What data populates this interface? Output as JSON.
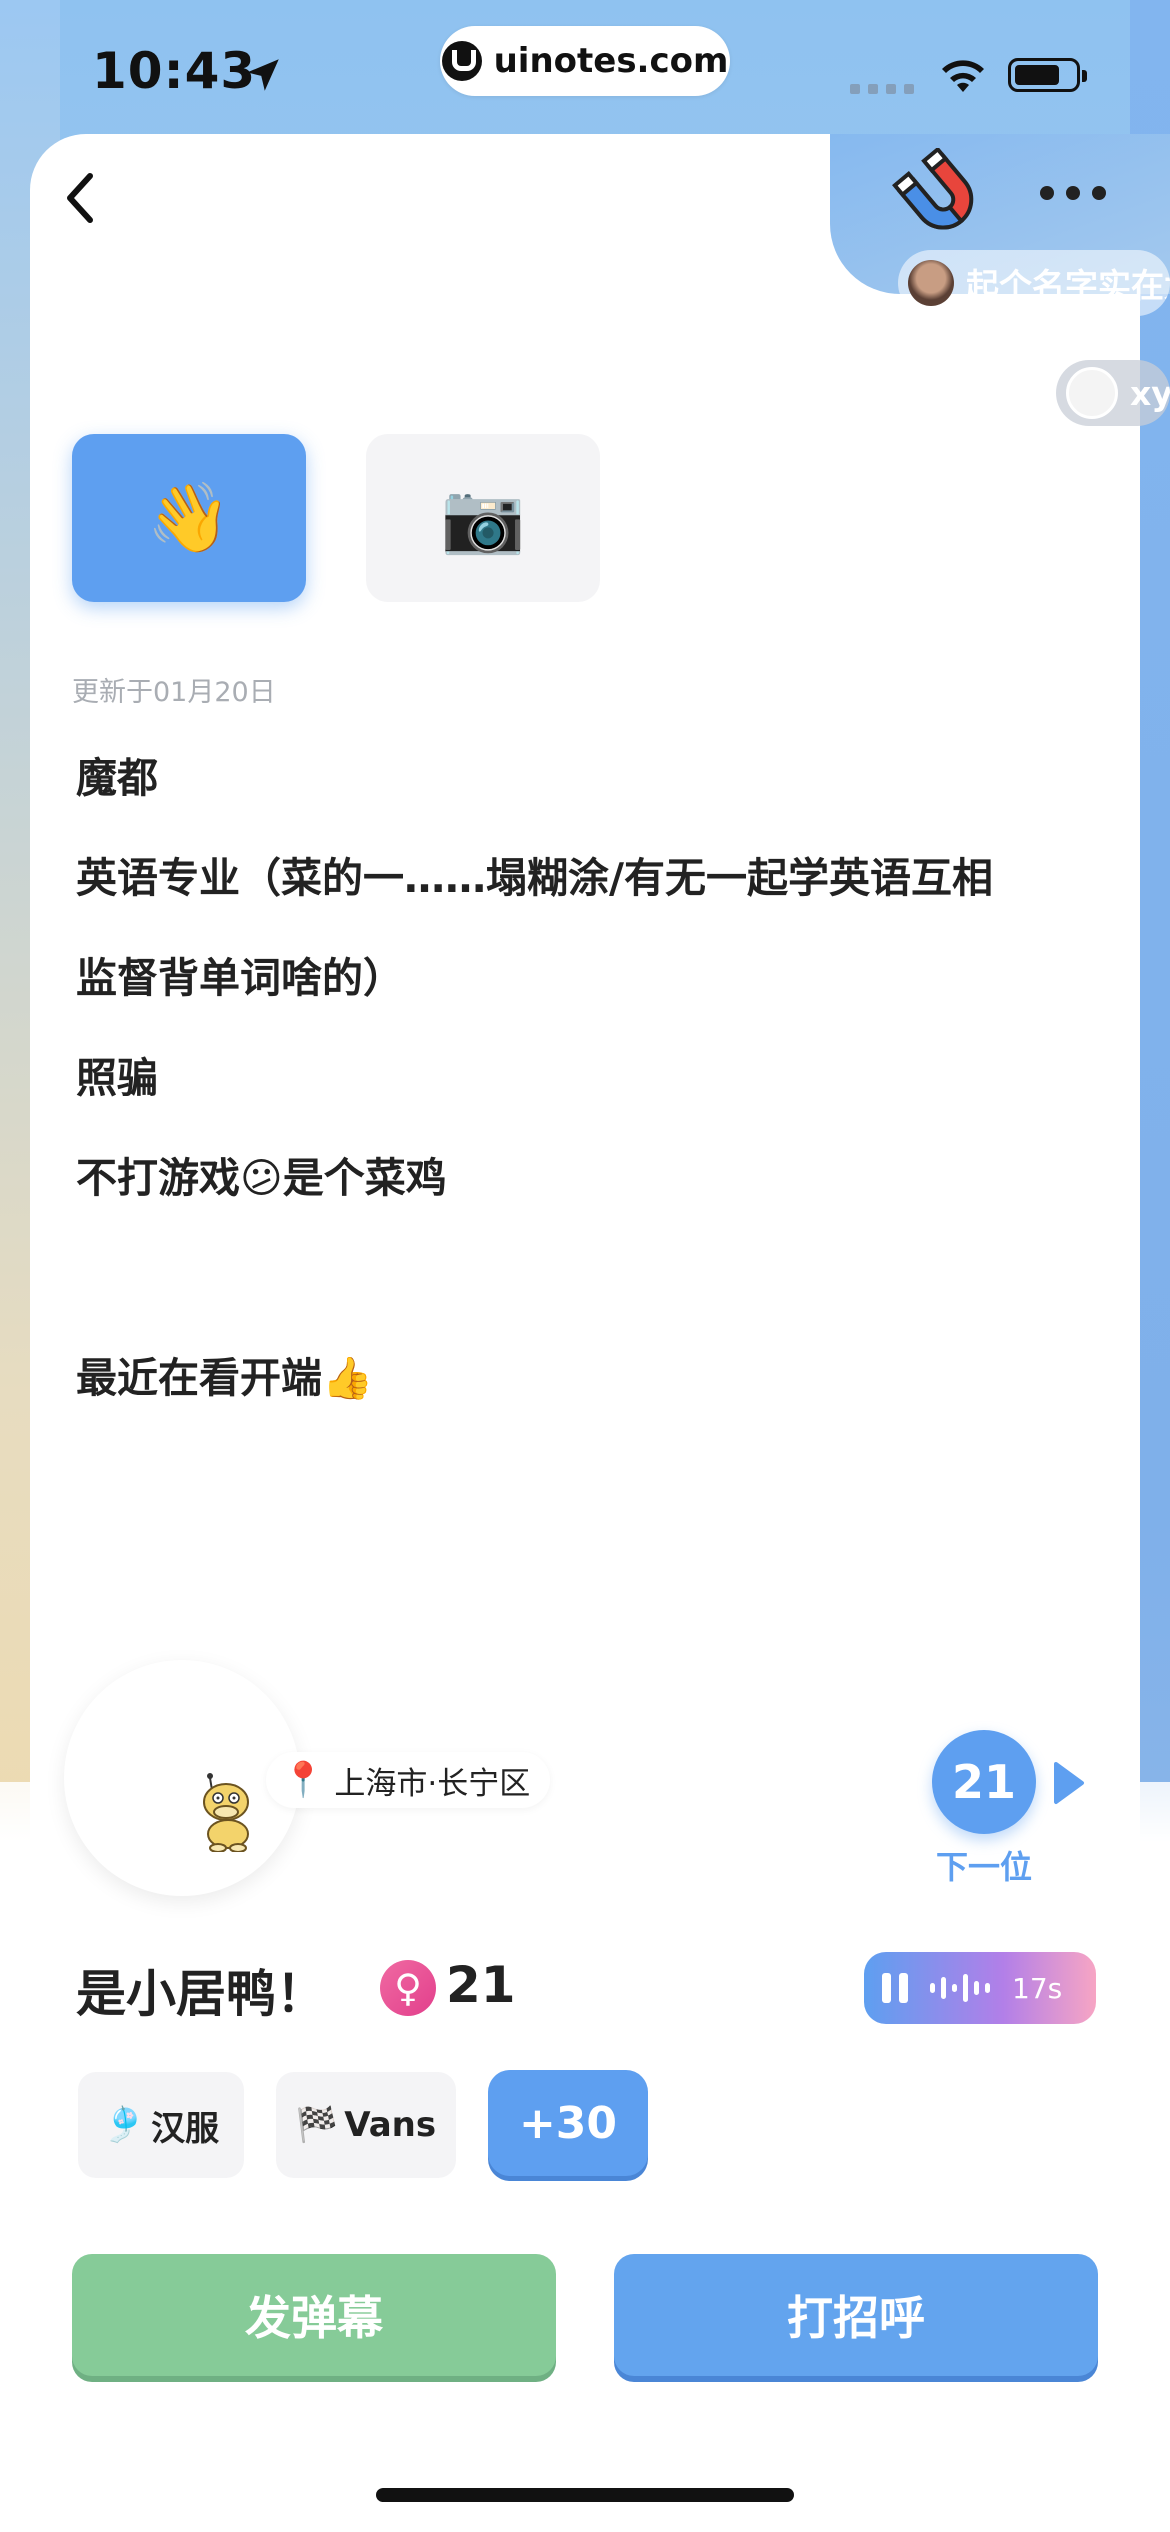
{
  "status_bar": {
    "time": "10:43",
    "url": "uinotes.com",
    "icons": [
      "location-arrow-icon",
      "signal-icon",
      "wifi-icon",
      "battery-icon"
    ]
  },
  "header": {
    "back_icon": "chevron-left-icon",
    "magnet_icon": "magnet-icon",
    "more_icon": "more-dots-icon"
  },
  "danmu": [
    {
      "text": "起个名字实在太"
    },
    {
      "text": "xyy"
    }
  ],
  "tabs": [
    {
      "icon": "👋",
      "name": "wave"
    },
    {
      "icon": "📷",
      "name": "camera"
    }
  ],
  "profile": {
    "updated": "更新于01月20日",
    "bio": [
      "魔都",
      "英语专业（菜的一……塌糊涂/有无一起学英语互相",
      "监督背单词啥的）",
      "照骗",
      "不打游戏😕是个菜鸡",
      "",
      "最近在看开端👍"
    ],
    "location": "上海市·长宁区",
    "name": "是小居鸭！",
    "gender_symbol": "♀",
    "age": "21",
    "voice_duration": "17s",
    "tags": [
      {
        "emoji": "🎐",
        "label": "汉服"
      },
      {
        "emoji": "🏁",
        "label": "Vans"
      }
    ],
    "more_tags": "+30"
  },
  "next": {
    "count": "21",
    "label": "下一位"
  },
  "actions": {
    "danmu_button": "发弹幕",
    "greet_button": "打招呼"
  },
  "colors": {
    "accent_blue": "#5e9ff0",
    "green": "#86cb98",
    "pink": "#e23f8c"
  }
}
